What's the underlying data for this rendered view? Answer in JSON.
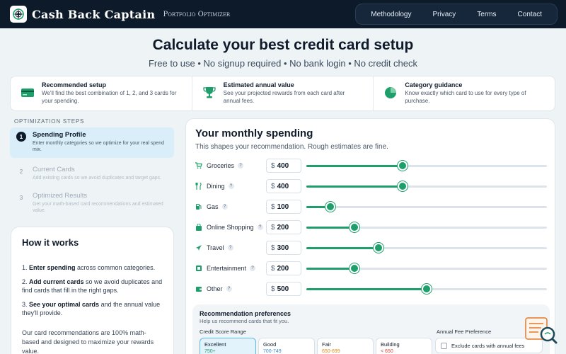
{
  "brand": {
    "name": "Cash Back Captain",
    "tagline": "Portfolio Optimizer"
  },
  "nav": {
    "items": [
      "Methodology",
      "Privacy",
      "Terms",
      "Contact"
    ]
  },
  "hero": {
    "title": "Calculate your best credit card setup",
    "subtitle": "Free to use • No signup required • No bank login • No credit check"
  },
  "features": [
    {
      "icon": "credit-card-icon",
      "title": "Recommended setup",
      "desc": "We'll find the best combination of 1, 2, and 3 cards for your spending."
    },
    {
      "icon": "trophy-icon",
      "title": "Estimated annual value",
      "desc": "See your projected rewards from each card after annual fees."
    },
    {
      "icon": "pie-chart-icon",
      "title": "Category guidance",
      "desc": "Know exactly which card to use for every type of purchase."
    }
  ],
  "steps": {
    "label": "OPTIMIZATION STEPS",
    "items": [
      {
        "num": "1",
        "title": "Spending Profile",
        "desc": "Enter monthly categories so we optimize for your real spend mix."
      },
      {
        "num": "2",
        "title": "Current Cards",
        "desc": "Add existing cards so we avoid duplicates and target gaps."
      },
      {
        "num": "3",
        "title": "Optimized Results",
        "desc": "Get your math-based card recommendations and estimated value."
      }
    ]
  },
  "how": {
    "title": "How it works",
    "items": [
      {
        "bold": "Enter spending",
        "rest": " across common categories.",
        "prefix": "1. "
      },
      {
        "bold": "Add current cards",
        "rest": " so we avoid duplicates and find cards that fill in the right gaps.",
        "prefix": "2. "
      },
      {
        "bold": "See your optimal cards",
        "rest": " and the annual value they'll provide.",
        "prefix": "3. "
      }
    ],
    "note": "Our card recommendations are 100% math-based and designed to maximize your rewards value."
  },
  "spending": {
    "title": "Your monthly spending",
    "subtitle": "This shapes your recommendation. Rough estimates are fine.",
    "currency": "$",
    "help_glyph": "?",
    "slider_max": 1000,
    "categories": [
      {
        "name": "Groceries",
        "amount": "400",
        "value": 400,
        "icon": "cart-icon"
      },
      {
        "name": "Dining",
        "amount": "400",
        "value": 400,
        "icon": "utensils-icon"
      },
      {
        "name": "Gas",
        "amount": "100",
        "value": 100,
        "icon": "gas-pump-icon"
      },
      {
        "name": "Online Shopping",
        "amount": "200",
        "value": 200,
        "icon": "shopping-bag-icon"
      },
      {
        "name": "Travel",
        "amount": "300",
        "value": 300,
        "icon": "plane-icon"
      },
      {
        "name": "Entertainment",
        "amount": "200",
        "value": 200,
        "icon": "film-icon"
      },
      {
        "name": "Other",
        "amount": "500",
        "value": 500,
        "icon": "wallet-icon"
      }
    ]
  },
  "prefs": {
    "title": "Recommendation preferences",
    "subtitle": "Help us recommend cards that fit you.",
    "credit_label": "Credit Score Range",
    "fee_label": "Annual Fee Preference",
    "fee_option": "Exclude cards with annual fees",
    "credit_options": [
      {
        "name": "Excellent",
        "range": "750+",
        "color": "#1e9e6a",
        "selected": true
      },
      {
        "name": "Good",
        "range": "700-749",
        "color": "#3b8fd1",
        "selected": false
      },
      {
        "name": "Fair",
        "range": "650-699",
        "color": "#e08a1a",
        "selected": false
      },
      {
        "name": "Building",
        "range": "< 650",
        "color": "#d9433a",
        "selected": false
      }
    ]
  },
  "colors": {
    "accent": "#1e9e6a",
    "nav_bg": "#0d1a2a",
    "widget": "#e07a2e"
  }
}
